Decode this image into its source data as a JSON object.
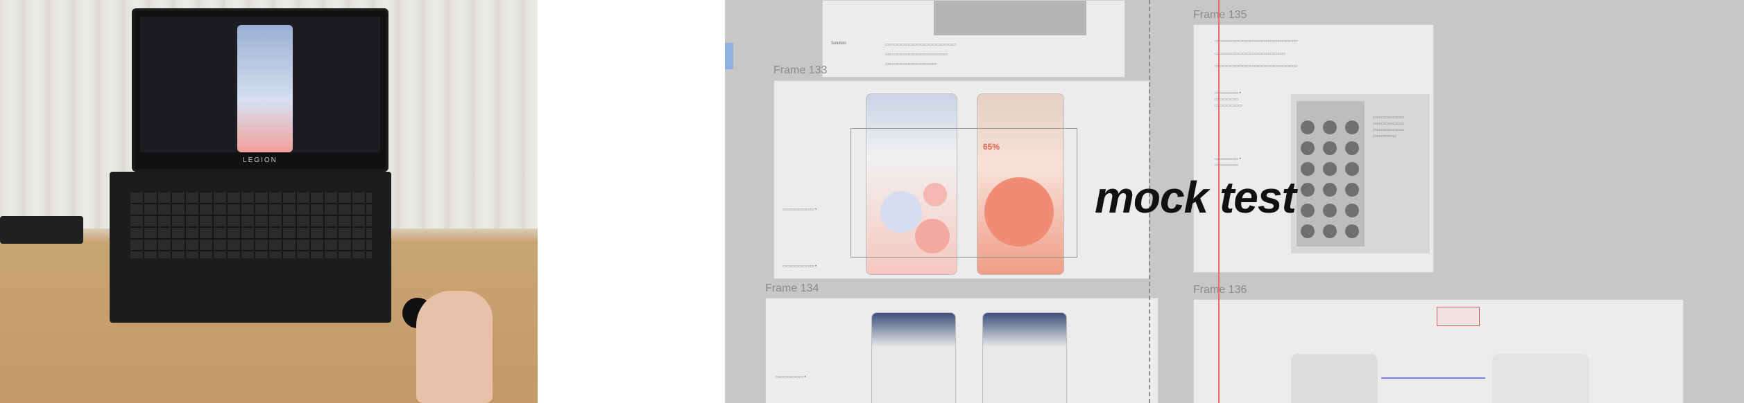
{
  "photo": {
    "laptop_brand": "LEGION"
  },
  "figma": {
    "frames": [
      {
        "id": "frame133",
        "label": "Frame 133"
      },
      {
        "id": "frame134",
        "label": "Frame 134"
      },
      {
        "id": "frame135",
        "label": "Frame 135"
      },
      {
        "id": "frame136",
        "label": "Frame 136"
      }
    ],
    "overlay_text": "mock test",
    "highlight_percent": "65%"
  },
  "colors": {
    "canvas_bg": "#c7c7c7",
    "frame_bg": "#ececec",
    "accent_red": "#e16d6d",
    "accent_blue": "#8fb1e0"
  }
}
